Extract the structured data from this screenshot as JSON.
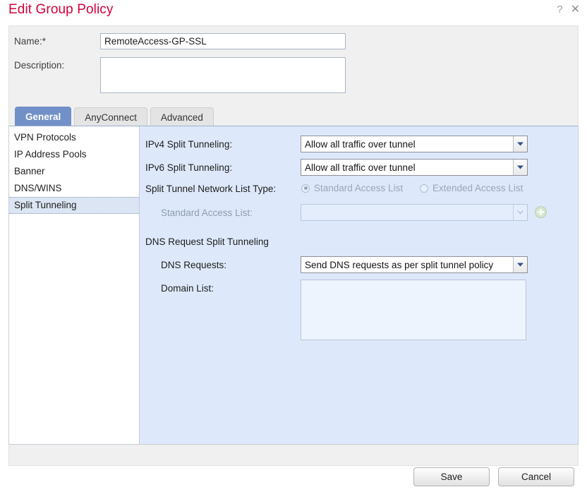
{
  "dialog": {
    "title": "Edit Group Policy",
    "help_icon": "?",
    "close_icon": "✕"
  },
  "form": {
    "name_label": "Name:*",
    "name_value": "RemoteAccess-GP-SSL",
    "name_placeholder": "",
    "description_label": "Description:",
    "description_value": "",
    "description_placeholder": ""
  },
  "tabs": [
    {
      "label": "General",
      "active": true
    },
    {
      "label": "AnyConnect",
      "active": false
    },
    {
      "label": "Advanced",
      "active": false
    }
  ],
  "sidebar": {
    "items": [
      {
        "label": "VPN Protocols",
        "selected": false
      },
      {
        "label": "IP Address Pools",
        "selected": false
      },
      {
        "label": "Banner",
        "selected": false
      },
      {
        "label": "DNS/WINS",
        "selected": false
      },
      {
        "label": "Split Tunneling",
        "selected": true
      }
    ]
  },
  "content": {
    "ipv4_label": "IPv4 Split Tunneling:",
    "ipv4_value": "Allow all traffic over tunnel",
    "ipv6_label": "IPv6 Split Tunneling:",
    "ipv6_value": "Allow all traffic over tunnel",
    "list_type_label": "Split Tunnel Network List Type:",
    "radio_standard": "Standard Access List",
    "radio_extended": "Extended Access List",
    "standard_access_list_label": "Standard Access List:",
    "standard_access_list_value": "",
    "dns_section_label": "DNS Request Split Tunneling",
    "dns_requests_label": "DNS Requests:",
    "dns_requests_value": "Send DNS requests as per split tunnel policy",
    "domain_list_label": "Domain List:",
    "domain_list_value": "",
    "domain_list_placeholder": ""
  },
  "footer": {
    "save_label": "Save",
    "cancel_label": "Cancel"
  },
  "colors": {
    "title": "#d4003c",
    "active_tab": "#7190c8",
    "content_panel": "#dde9fb",
    "selection": "#dbe5f3"
  }
}
